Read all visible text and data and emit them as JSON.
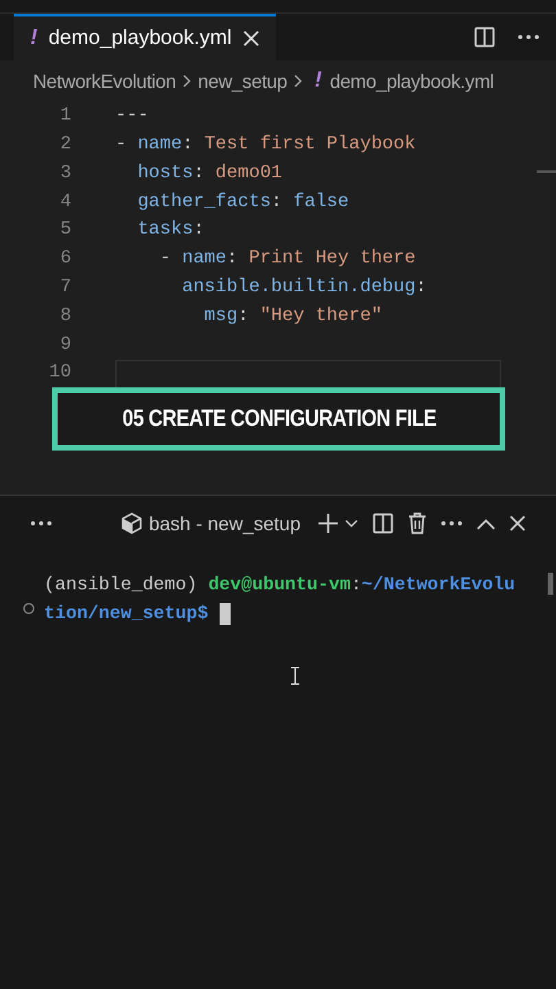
{
  "tabs": [
    {
      "icon": "!",
      "label": "demo_playbook.yml",
      "selected": true
    }
  ],
  "breadcrumb": [
    {
      "label": "NetworkEvolution"
    },
    {
      "label": "new_setup"
    },
    {
      "icon": "!",
      "label": "demo_playbook.yml"
    }
  ],
  "editor": {
    "lines": [
      {
        "number": "1",
        "tokens": [
          {
            "kind": "punct",
            "text": "---"
          }
        ]
      },
      {
        "number": "2",
        "tokens": [
          {
            "kind": "punct",
            "text": "- "
          },
          {
            "kind": "key",
            "text": "name"
          },
          {
            "kind": "punct",
            "text": ": "
          },
          {
            "kind": "str",
            "text": "Test first Playbook"
          }
        ]
      },
      {
        "number": "3",
        "tokens": [
          {
            "kind": "key",
            "text": "  hosts"
          },
          {
            "kind": "punct",
            "text": ": "
          },
          {
            "kind": "str",
            "text": "demo01"
          }
        ]
      },
      {
        "number": "4",
        "tokens": [
          {
            "kind": "key",
            "text": "  gather_facts"
          },
          {
            "kind": "punct",
            "text": ": "
          },
          {
            "kind": "bool",
            "text": "false"
          }
        ]
      },
      {
        "number": "5",
        "tokens": [
          {
            "kind": "key",
            "text": "  tasks"
          },
          {
            "kind": "punct",
            "text": ":"
          }
        ]
      },
      {
        "number": "6",
        "tokens": [
          {
            "kind": "punct",
            "text": "    - "
          },
          {
            "kind": "key",
            "text": "name"
          },
          {
            "kind": "punct",
            "text": ": "
          },
          {
            "kind": "str",
            "text": "Print Hey there"
          }
        ]
      },
      {
        "number": "7",
        "tokens": [
          {
            "kind": "key",
            "text": "      ansible.builtin.debug"
          },
          {
            "kind": "punct",
            "text": ":"
          }
        ]
      },
      {
        "number": "8",
        "tokens": [
          {
            "kind": "key",
            "text": "        msg"
          },
          {
            "kind": "punct",
            "text": ": "
          },
          {
            "kind": "str",
            "text": "\"Hey there\""
          }
        ]
      },
      {
        "number": "9"
      },
      {
        "number": "10",
        "current": true
      }
    ]
  },
  "overlay": {
    "caption": "05 CREATE CONFIGURATION FILE"
  },
  "terminal": {
    "title": "bash - new_setup",
    "lines": [
      [
        {
          "kind": "plain",
          "text": "(ansible_demo) "
        },
        {
          "kind": "user",
          "text": "dev@ubuntu-vm"
        },
        {
          "kind": "plain",
          "text": ":"
        },
        {
          "kind": "path",
          "text": "~/NetworkEvolu"
        }
      ],
      [
        {
          "kind": "path",
          "text": "tion/new_setup$ "
        }
      ]
    ]
  }
}
